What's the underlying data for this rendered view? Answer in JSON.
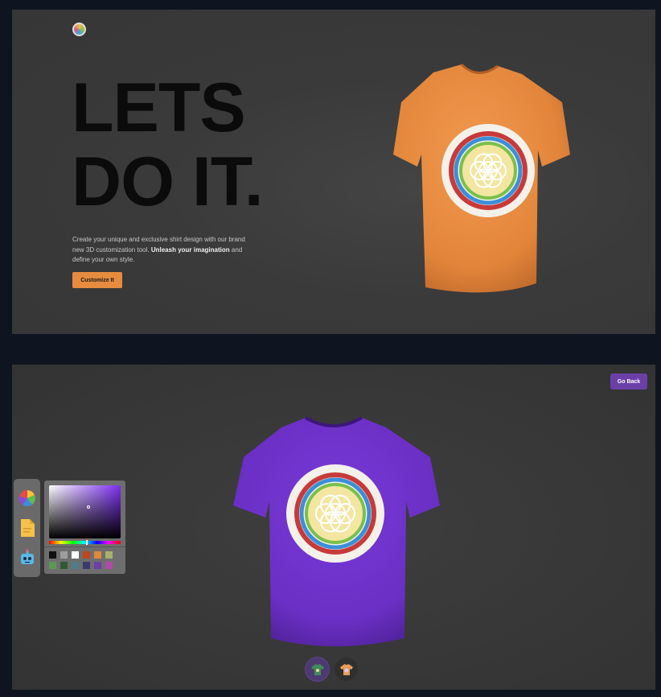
{
  "home": {
    "title_line1": "LETS",
    "title_line2": "DO IT.",
    "desc_part1": "Create your unique and exclusive shirt design with our brand new 3D customization tool.",
    "desc_bold": "Unleash your imagination",
    "desc_part2": "and define your own style.",
    "button_label": "Customize It",
    "shirt_color": "#e88b3e",
    "accent_color": "#e78b3f"
  },
  "customizer": {
    "back_button_label": "Go Back",
    "shirt_color": "#6a2fc4",
    "editor_tabs": [
      {
        "icon": "color-wheel-icon"
      },
      {
        "icon": "file-icon"
      },
      {
        "icon": "ai-robot-icon"
      }
    ],
    "color_picker": {
      "selected_hue": "#7c2ff0",
      "swatches": [
        "#111111",
        "#9e9e9e",
        "#ffffff",
        "#c0461f",
        "#e0883c",
        "#a8b06a",
        "#5a9a52",
        "#2f5a33",
        "#4d7d8a",
        "#3a3a6e",
        "#6a3fa6",
        "#b04aa8"
      ]
    },
    "filter_tabs": [
      {
        "icon": "logo-shirt-icon"
      },
      {
        "icon": "stylish-shirt-icon"
      }
    ]
  }
}
